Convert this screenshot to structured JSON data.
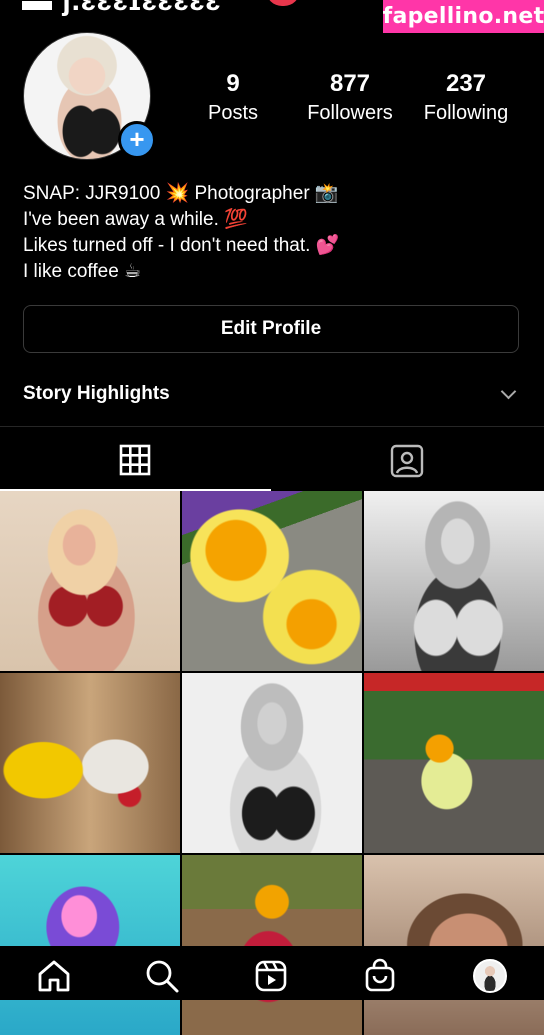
{
  "header": {
    "watermark": "fapellino.net"
  },
  "profile": {
    "stats": [
      {
        "value": "9",
        "label": "Posts"
      },
      {
        "value": "877",
        "label": "Followers"
      },
      {
        "value": "237",
        "label": "Following"
      }
    ],
    "bio": [
      "SNAP: JJR9100 💥 Photographer 📸",
      "I've been away a while. 💯",
      "Likes turned off - I don't need that. 💕",
      "I like coffee ☕"
    ],
    "edit_profile_label": "Edit Profile",
    "story_highlights_label": "Story Highlights",
    "add_badge": "+"
  },
  "tabs": [
    {
      "icon": "grid-icon",
      "active": true
    },
    {
      "icon": "tagged-icon",
      "active": false
    }
  ],
  "grid_posts": [
    "portrait-red-lingerie",
    "orange-drinks",
    "bw-portrait",
    "gin-cocktail",
    "bw-portrait-2",
    "lemonade-glass",
    "cyan-portrait",
    "raspberry-drink",
    "selfie-portrait"
  ],
  "bottom_nav": [
    {
      "icon": "home-icon"
    },
    {
      "icon": "search-icon"
    },
    {
      "icon": "reels-icon"
    },
    {
      "icon": "shop-icon"
    },
    {
      "icon": "profile-avatar"
    }
  ],
  "colors": {
    "background": "#000000",
    "accent_blue": "#3797f0",
    "watermark_pink": "#ff36a8"
  }
}
